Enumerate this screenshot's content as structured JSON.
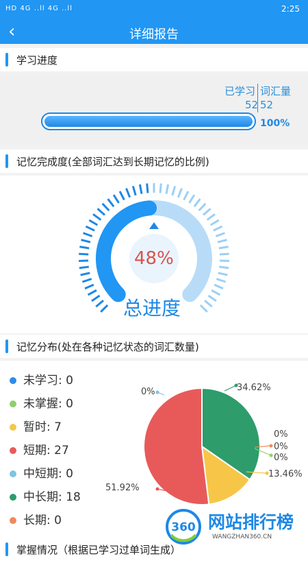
{
  "status": {
    "left": "HD 4G ..ll 4G ..ll",
    "time": "2:25"
  },
  "header": {
    "back_icon": "back-arrow-icon",
    "title": "详细报告"
  },
  "section1": {
    "title": "学习进度",
    "learned_label": "已学习",
    "vocab_label": "词汇量",
    "learned_value": "52",
    "vocab_value": "52",
    "progress_pct": 100,
    "progress_text": "100%"
  },
  "section2": {
    "title": "记忆完成度(全部词汇达到长期记忆的比例)",
    "pct_value": 48,
    "pct_text": "48%",
    "gauge_title": "总进度"
  },
  "section3": {
    "title": "记忆分布(处在各种记忆状态的词汇数量)",
    "legend": [
      {
        "label": "未学习: 0",
        "color": "#2f8be6"
      },
      {
        "label": "未掌握: 0",
        "color": "#8fd06a"
      },
      {
        "label": "暂时: 7",
        "color": "#f7c648"
      },
      {
        "label": "短期: 27",
        "color": "#e85a5a"
      },
      {
        "label": "中短期: 0",
        "color": "#7fc3e8"
      },
      {
        "label": "中长期: 18",
        "color": "#2e9c6b"
      },
      {
        "label": "长期: 0",
        "color": "#f08a5d"
      }
    ]
  },
  "chart_data": {
    "type": "pie",
    "categories": [
      "未学习",
      "未掌握",
      "暂时",
      "短期",
      "中短期",
      "中长期",
      "长期"
    ],
    "values": [
      0,
      0,
      7,
      27,
      0,
      18,
      0
    ],
    "labels": [
      "0%",
      "0%",
      "13.46%",
      "51.92%",
      "0%",
      "34.62%",
      "0%"
    ]
  },
  "section4": {
    "title": "掌握情况（根据已学习过单词生成）"
  },
  "watermark": {
    "logo": "360",
    "text": "网站排行榜",
    "url": "WANGZHAN360.CN"
  }
}
